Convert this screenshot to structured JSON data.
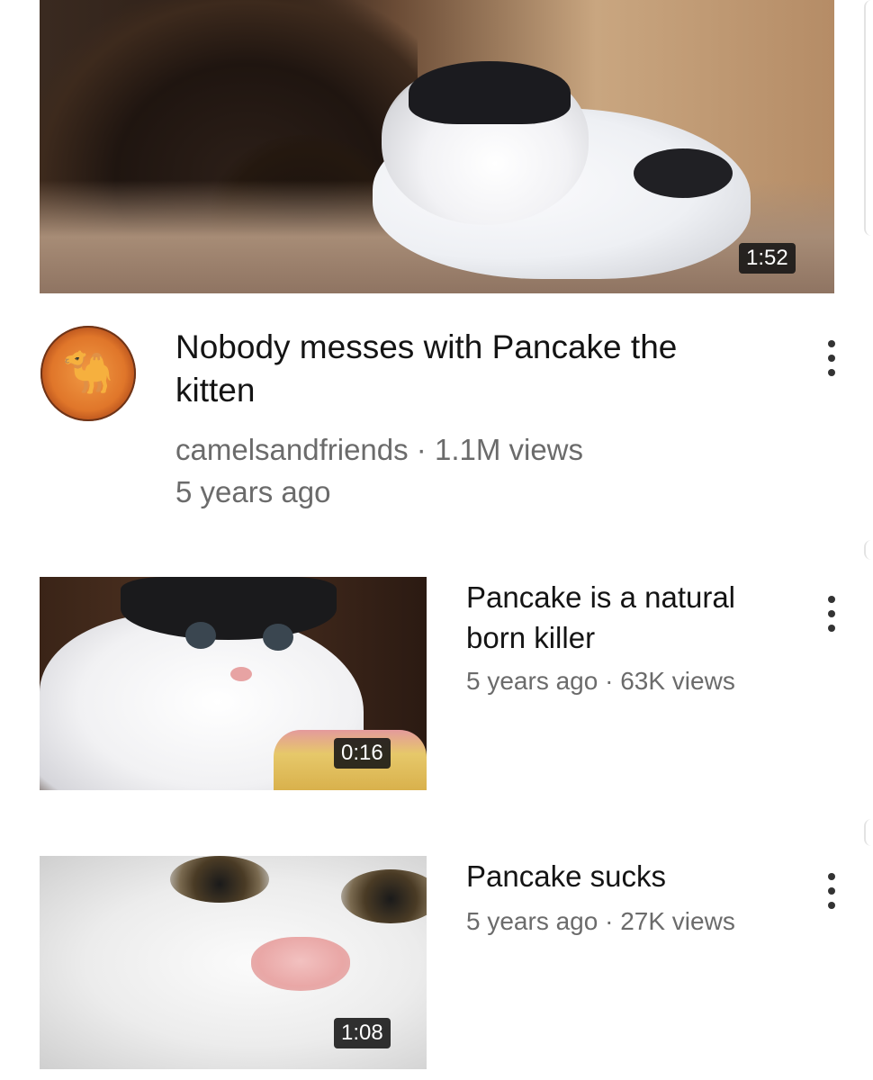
{
  "featured": {
    "duration": "1:52",
    "title": "Nobody messes with Pancake the kitten",
    "meta_line_1": "camelsandfriends · 1.1M views",
    "meta_line_2": "5 years ago",
    "avatar_icon": "camel-logo-icon",
    "avatar_glyph": "🐪"
  },
  "videos": [
    {
      "title": "Pancake is a natural born killer",
      "meta": "5 years ago · 63K views",
      "duration": "0:16"
    },
    {
      "title": "Pancake sucks",
      "meta": "5 years ago · 27K views",
      "duration": "1:08"
    }
  ],
  "icons": {
    "more": "more-vertical-icon"
  },
  "colors": {
    "background": "#ffffff",
    "title_text": "#141414",
    "meta_text": "#6b6b6b",
    "duration_badge": "#141414",
    "avatar_orange": "#e0762a"
  }
}
